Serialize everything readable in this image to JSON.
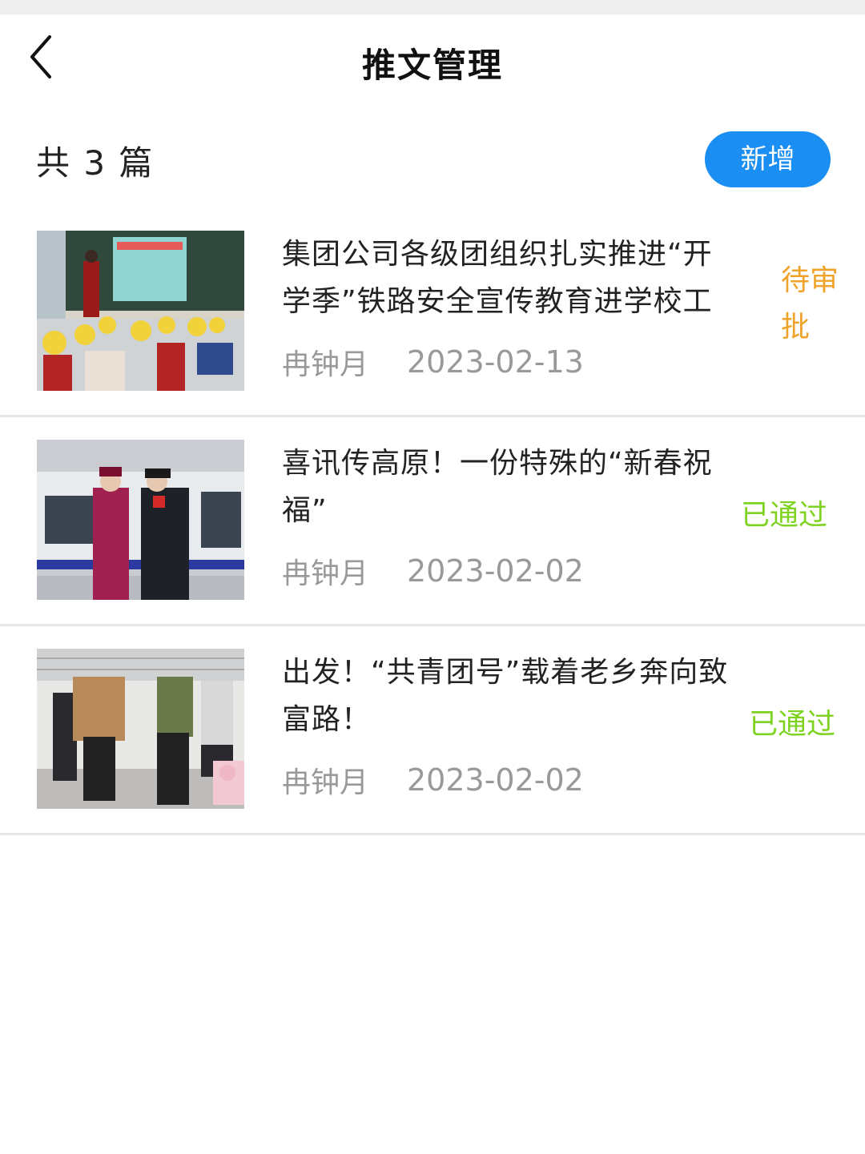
{
  "header": {
    "title": "推文管理",
    "back_icon": "chevron-left-icon"
  },
  "summary": {
    "text": "共 3 篇"
  },
  "actions": {
    "add_label": "新增",
    "add_color": "#1a8ef2"
  },
  "articles": [
    {
      "title": "集团公司各级团组织扎实推进“开学季”铁路安全宣传教育进学校工",
      "author": "冉钟月",
      "date": "2023-02-13",
      "status": "待审批",
      "status_color": "#f0a32a"
    },
    {
      "title": "喜讯传高原！一份特殊的“新春祝福”",
      "author": "冉钟月",
      "date": "2023-02-02",
      "status": "已通过",
      "status_color": "#7ed321"
    },
    {
      "title": "出发！“共青团号”载着老乡奔向致富路！",
      "author": "冉钟月",
      "date": "2023-02-02",
      "status": "已通过",
      "status_color": "#7ed321"
    }
  ]
}
